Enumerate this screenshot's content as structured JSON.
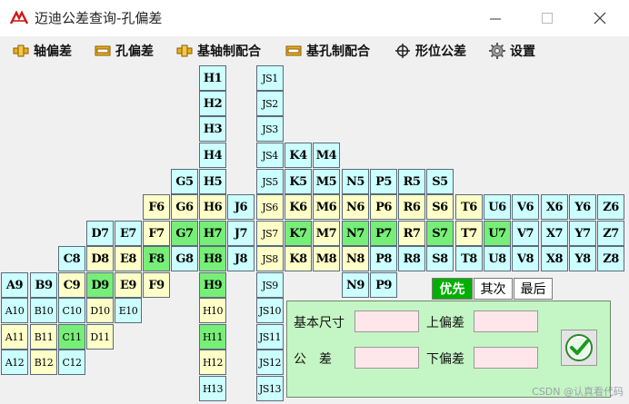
{
  "window": {
    "title": "迈迪公差查询-孔偏差",
    "logo_text": "MD"
  },
  "menu": [
    {
      "label": "轴偏差",
      "icon": "shaft-icon"
    },
    {
      "label": "孔偏差",
      "icon": "hole-icon"
    },
    {
      "label": "基轴制配合",
      "icon": "shaft-basis-icon"
    },
    {
      "label": "基孔制配合",
      "icon": "hole-basis-icon"
    },
    {
      "label": "形位公差",
      "icon": "crosshair-icon"
    },
    {
      "label": "设置",
      "icon": "gear-icon"
    }
  ],
  "grid": [
    {
      "label": "H1",
      "color": "cyan"
    },
    {
      "label": "JS1",
      "color": "cyan"
    },
    {
      "label": "H2",
      "color": "cyan"
    },
    {
      "label": "JS2",
      "color": "cyan"
    },
    {
      "label": "H3",
      "color": "cyan"
    },
    {
      "label": "JS3",
      "color": "cyan"
    },
    {
      "label": "H4",
      "color": "cyan"
    },
    {
      "label": "JS4",
      "color": "cyan"
    },
    {
      "label": "K4",
      "color": "cyan"
    },
    {
      "label": "M4",
      "color": "cyan"
    },
    {
      "label": "G5",
      "color": "cyan"
    },
    {
      "label": "H5",
      "color": "cyan"
    },
    {
      "label": "JS5",
      "color": "cyan"
    },
    {
      "label": "K5",
      "color": "cyan"
    },
    {
      "label": "M5",
      "color": "cyan"
    },
    {
      "label": "N5",
      "color": "cyan"
    },
    {
      "label": "P5",
      "color": "cyan"
    },
    {
      "label": "R5",
      "color": "cyan"
    },
    {
      "label": "S5",
      "color": "cyan"
    },
    {
      "label": "F6",
      "color": "yellow"
    },
    {
      "label": "G6",
      "color": "yellow"
    },
    {
      "label": "H6",
      "color": "yellow"
    },
    {
      "label": "J6",
      "color": "cyan"
    },
    {
      "label": "JS6",
      "color": "yellow"
    },
    {
      "label": "K6",
      "color": "yellow"
    },
    {
      "label": "M6",
      "color": "yellow"
    },
    {
      "label": "N6",
      "color": "yellow"
    },
    {
      "label": "P6",
      "color": "yellow"
    },
    {
      "label": "R6",
      "color": "yellow"
    },
    {
      "label": "S6",
      "color": "yellow"
    },
    {
      "label": "T6",
      "color": "yellow"
    },
    {
      "label": "U6",
      "color": "cyan"
    },
    {
      "label": "V6",
      "color": "cyan"
    },
    {
      "label": "X6",
      "color": "cyan"
    },
    {
      "label": "Y6",
      "color": "cyan"
    },
    {
      "label": "Z6",
      "color": "cyan"
    },
    {
      "label": "D7",
      "color": "cyan"
    },
    {
      "label": "E7",
      "color": "cyan"
    },
    {
      "label": "F7",
      "color": "yellow"
    },
    {
      "label": "G7",
      "color": "green"
    },
    {
      "label": "H7",
      "color": "green"
    },
    {
      "label": "J7",
      "color": "cyan"
    },
    {
      "label": "JS7",
      "color": "yellow"
    },
    {
      "label": "K7",
      "color": "green"
    },
    {
      "label": "M7",
      "color": "yellow"
    },
    {
      "label": "N7",
      "color": "green"
    },
    {
      "label": "P7",
      "color": "green"
    },
    {
      "label": "R7",
      "color": "yellow"
    },
    {
      "label": "S7",
      "color": "green"
    },
    {
      "label": "T7",
      "color": "yellow"
    },
    {
      "label": "U7",
      "color": "green"
    },
    {
      "label": "V7",
      "color": "cyan"
    },
    {
      "label": "X7",
      "color": "cyan"
    },
    {
      "label": "Y7",
      "color": "cyan"
    },
    {
      "label": "Z7",
      "color": "cyan"
    },
    {
      "label": "C8",
      "color": "cyan"
    },
    {
      "label": "D8",
      "color": "yellow"
    },
    {
      "label": "E8",
      "color": "yellow"
    },
    {
      "label": "F8",
      "color": "green"
    },
    {
      "label": "G8",
      "color": "cyan"
    },
    {
      "label": "H8",
      "color": "green"
    },
    {
      "label": "J8",
      "color": "cyan"
    },
    {
      "label": "JS8",
      "color": "yellow"
    },
    {
      "label": "K8",
      "color": "yellow"
    },
    {
      "label": "M8",
      "color": "yellow"
    },
    {
      "label": "N8",
      "color": "yellow"
    },
    {
      "label": "P8",
      "color": "cyan"
    },
    {
      "label": "R8",
      "color": "cyan"
    },
    {
      "label": "S8",
      "color": "cyan"
    },
    {
      "label": "T8",
      "color": "cyan"
    },
    {
      "label": "U8",
      "color": "cyan"
    },
    {
      "label": "V8",
      "color": "cyan"
    },
    {
      "label": "X8",
      "color": "cyan"
    },
    {
      "label": "Y8",
      "color": "cyan"
    },
    {
      "label": "Z8",
      "color": "cyan"
    },
    {
      "label": "A9",
      "color": "cyan"
    },
    {
      "label": "B9",
      "color": "cyan"
    },
    {
      "label": "C9",
      "color": "yellow"
    },
    {
      "label": "D9",
      "color": "green"
    },
    {
      "label": "E9",
      "color": "yellow"
    },
    {
      "label": "F9",
      "color": "yellow"
    },
    {
      "label": "H9",
      "color": "green"
    },
    {
      "label": "JS9",
      "color": "cyan"
    },
    {
      "label": "N9",
      "color": "cyan"
    },
    {
      "label": "P9",
      "color": "cyan"
    },
    {
      "label": "A10",
      "color": "cyan"
    },
    {
      "label": "B10",
      "color": "cyan"
    },
    {
      "label": "C10",
      "color": "cyan"
    },
    {
      "label": "D10",
      "color": "yellow"
    },
    {
      "label": "E10",
      "color": "cyan"
    },
    {
      "label": "H10",
      "color": "yellow"
    },
    {
      "label": "JS10",
      "color": "cyan"
    },
    {
      "label": "A11",
      "color": "yellow"
    },
    {
      "label": "B11",
      "color": "yellow"
    },
    {
      "label": "C11",
      "color": "green"
    },
    {
      "label": "D11",
      "color": "yellow"
    },
    {
      "label": "H11",
      "color": "green"
    },
    {
      "label": "JS11",
      "color": "cyan"
    },
    {
      "label": "A12",
      "color": "cyan"
    },
    {
      "label": "B12",
      "color": "yellow"
    },
    {
      "label": "C12",
      "color": "cyan"
    },
    {
      "label": "H12",
      "color": "yellow"
    },
    {
      "label": "JS12",
      "color": "cyan"
    },
    {
      "label": "H13",
      "color": "cyan"
    },
    {
      "label": "JS13",
      "color": "cyan"
    }
  ],
  "tabs": [
    {
      "label": "优先",
      "active": true
    },
    {
      "label": "其次",
      "active": false
    },
    {
      "label": "最后",
      "active": false
    }
  ],
  "panel": {
    "basic_size_label": "基本尺寸",
    "basic_size_value": "",
    "upper_dev_label": "上偏差",
    "upper_dev_value": "",
    "tolerance_label": "公　差",
    "tolerance_value": "",
    "lower_dev_label": "下偏差",
    "lower_dev_value": "",
    "confirm_icon": "checkmark-icon"
  },
  "watermark": "CSDN @认真看代码",
  "colors": {
    "cyan": "#ccffff",
    "yellow": "#ffffc8",
    "green": "#77ee77",
    "tab_active": "#00b000",
    "panel_bg": "#c4f5c4",
    "input_bg": "#ffe6ea"
  }
}
